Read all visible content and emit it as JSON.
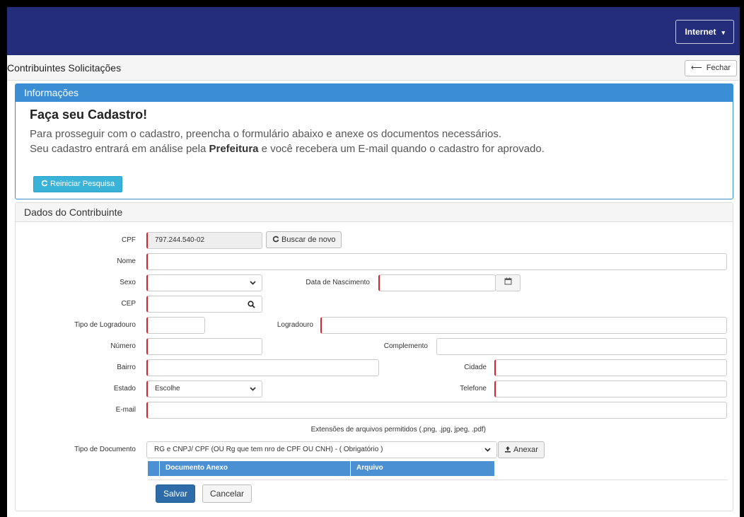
{
  "header": {
    "env_label": "Internet",
    "env_caret": "▾"
  },
  "titlebar": {
    "title": "Contribuintes Solicitações",
    "close_label": "Fechar",
    "close_arrow": "⟵"
  },
  "info": {
    "heading": "Informações",
    "title": "Faça seu Cadastro!",
    "line1": "Para prosseguir com o cadastro, preencha o formulário abaixo e anexe os documentos necessários.",
    "line2_pre": "Seu cadastro entrará em análise pela ",
    "line2_bold": "Prefeitura",
    "line2_post": " e você recebera um E-mail quando o cadastro for aprovado.",
    "restart_label": "Reiniciar Pesquisa"
  },
  "form": {
    "heading": "Dados do Contribuinte",
    "cpf_label": "CPF",
    "cpf_value": "797.244.540-02",
    "search_again_label": "Buscar de novo",
    "nome_label": "Nome",
    "sexo_label": "Sexo",
    "nascimento_label": "Data de Nascimento",
    "cep_label": "CEP",
    "tipo_logradouro_label": "Tipo de Logradouro",
    "logradouro_label": "Logradouro",
    "numero_label": "Número",
    "complemento_label": "Complemento",
    "bairro_label": "Bairro",
    "cidade_label": "Cidade",
    "estado_label": "Estado",
    "estado_value": "Escolhe",
    "telefone_label": "Telefone",
    "email_label": "E-mail",
    "extensions_note": "Extensões de arquivos permitidos (.png, .jpg, jpeg, .pdf)",
    "tipo_documento_label": "Tipo de Documento",
    "tipo_documento_value": "RG e CNPJ/ CPF (OU Rg que tem nro de CPF OU CNH) - ( Obrigatório )",
    "attach_label": "Anexar",
    "table_headers": [
      "Documento Anexo",
      "Arquivo"
    ],
    "save_label": "Salvar",
    "cancel_label": "Cancelar"
  },
  "colors": {
    "topbar": "#232d7a",
    "info_blue": "#3b8dd4",
    "restart_cyan": "#39b3d7",
    "required_red": "#d9232d",
    "save_blue": "#2d6ca8"
  }
}
